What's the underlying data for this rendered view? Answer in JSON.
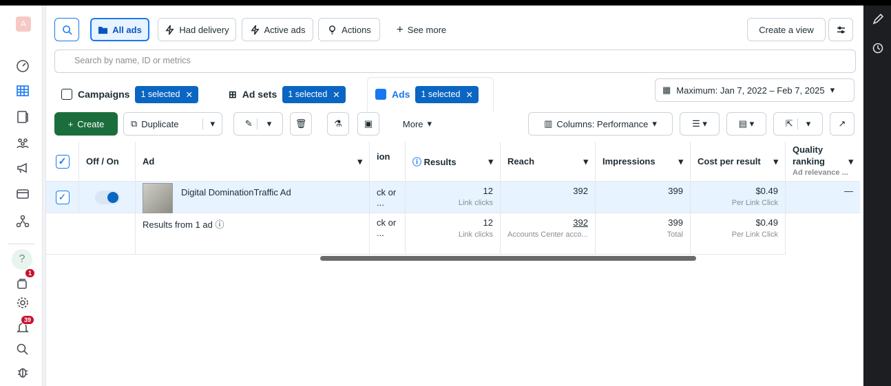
{
  "user": {
    "avatar_letter": "A"
  },
  "sidebar": {
    "notifications_badge": "1",
    "alerts_badge": "39",
    "help_label": "?"
  },
  "filters": {
    "all_ads": "All ads",
    "had_delivery": "Had delivery",
    "active_ads": "Active ads",
    "actions": "Actions",
    "see_more": "See more",
    "create_view": "Create a view"
  },
  "search": {
    "placeholder": "Search by name, ID or metrics"
  },
  "tabs": [
    {
      "label": "Campaigns",
      "selected": "1 selected"
    },
    {
      "label": "Ad sets",
      "selected": "1 selected"
    },
    {
      "label": "Ads",
      "selected": "1 selected"
    }
  ],
  "date_range": "Maximum: Jan 7, 2022 – Feb 7, 2025",
  "toolbar": {
    "create": "Create",
    "duplicate": "Duplicate",
    "more": "More",
    "columns": "Columns: Performance"
  },
  "table": {
    "headers": {
      "off_on": "Off / On",
      "ad": "Ad",
      "attribution_partial": "ion",
      "results": "Results",
      "reach": "Reach",
      "impressions": "Impressions",
      "cost_per_result": "Cost per result",
      "quality_ranking": "Quality ranking",
      "quality_sub": "Ad relevance ..."
    },
    "row": {
      "ad_name": "Digital DominationTraffic Ad",
      "attribution": "ck or ...",
      "results": "12",
      "results_sub": "Link clicks",
      "reach": "392",
      "impressions": "399",
      "cost": "$0.49",
      "cost_sub": "Per Link Click",
      "quality": "—"
    },
    "summary": {
      "label": "Results from 1 ad",
      "attribution": "ck or ...",
      "results": "12",
      "results_sub": "Link clicks",
      "reach": "392",
      "reach_sub": "Accounts Center acco...",
      "impressions": "399",
      "impressions_sub": "Total",
      "cost": "$0.49",
      "cost_sub": "Per Link Click"
    }
  }
}
